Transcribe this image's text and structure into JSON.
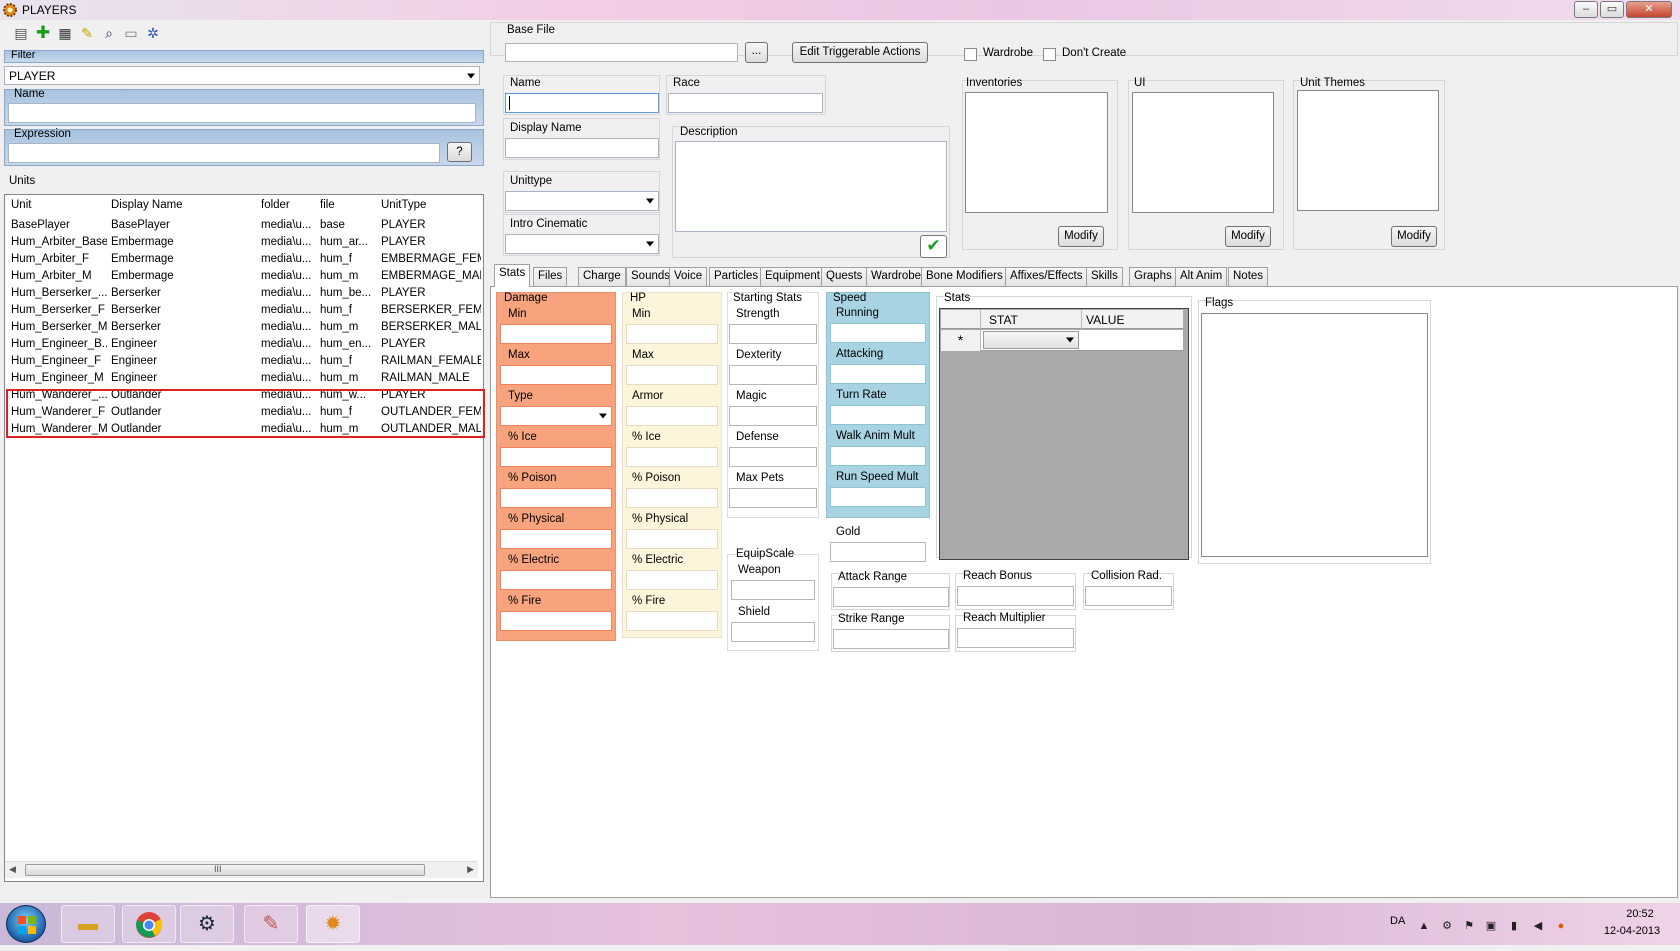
{
  "window": {
    "title": "PLAYERS"
  },
  "filter": {
    "group_label": "Filter",
    "selected": "PLAYER",
    "name_label": "Name",
    "name_value": "",
    "expression_label": "Expression",
    "expression_value": "",
    "help_button": "?"
  },
  "units": {
    "label": "Units",
    "columns": [
      "Unit",
      "Display Name",
      "folder",
      "file",
      "UnitType"
    ],
    "rows": [
      [
        "BasePlayer",
        "BasePlayer",
        "media\\u...",
        "base",
        "PLAYER"
      ],
      [
        "Hum_Arbiter_Base",
        "Embermage",
        "media\\u...",
        "hum_ar...",
        "PLAYER"
      ],
      [
        "Hum_Arbiter_F",
        "Embermage",
        "media\\u...",
        "hum_f",
        "EMBERMAGE_FEMA"
      ],
      [
        "Hum_Arbiter_M",
        "Embermage",
        "media\\u...",
        "hum_m",
        "EMBERMAGE_MALI"
      ],
      [
        "Hum_Berserker_...",
        "Berserker",
        "media\\u...",
        "hum_be...",
        "PLAYER"
      ],
      [
        "Hum_Berserker_F",
        "Berserker",
        "media\\u...",
        "hum_f",
        "BERSERKER_FEMA"
      ],
      [
        "Hum_Berserker_M",
        "Berserker",
        "media\\u...",
        "hum_m",
        "BERSERKER_MALE"
      ],
      [
        "Hum_Engineer_B...",
        "Engineer",
        "media\\u...",
        "hum_en...",
        "PLAYER"
      ],
      [
        "Hum_Engineer_F",
        "Engineer",
        "media\\u...",
        "hum_f",
        "RAILMAN_FEMALE"
      ],
      [
        "Hum_Engineer_M",
        "Engineer",
        "media\\u...",
        "hum_m",
        "RAILMAN_MALE"
      ],
      [
        "Hum_Wanderer_...",
        "Outlander",
        "media\\u...",
        "hum_w...",
        "PLAYER"
      ],
      [
        "Hum_Wanderer_F",
        "Outlander",
        "media\\u...",
        "hum_f",
        "OUTLANDER_FEMA"
      ],
      [
        "Hum_Wanderer_M",
        "Outlander",
        "media\\u...",
        "hum_m",
        "OUTLANDER_MALE"
      ]
    ],
    "scroll_grip": "III"
  },
  "form": {
    "base_file_label": "Base File",
    "base_file_value": "",
    "browse_button": "...",
    "edit_triggerable_button": "Edit Triggerable Actions",
    "wardrobe_label": "Wardrobe",
    "dont_create_label": "Don't Create",
    "name_label": "Name",
    "race_label": "Race",
    "display_name_label": "Display Name",
    "description_label": "Description",
    "unittype_label": "Unittype",
    "intro_cinematic_label": "Intro Cinematic",
    "inventories_label": "Inventories",
    "ui_label": "UI",
    "unit_themes_label": "Unit Themes",
    "modify_label": "Modify"
  },
  "tabs": [
    "Stats",
    "Files",
    "Charge",
    "Sounds",
    "Voice",
    "Particles",
    "Equipment",
    "Quests",
    "Wardrobe",
    "Bone Modifiers",
    "Affixes/Effects",
    "Skills",
    "Graphs",
    "Alt Anim",
    "Notes"
  ],
  "stats": {
    "damage": {
      "title": "Damage",
      "fields": [
        "Min",
        "Max",
        "Type",
        "% Ice",
        "% Poison",
        "% Physical",
        "% Electric",
        "% Fire"
      ]
    },
    "hp": {
      "title": "HP",
      "fields": [
        "Min",
        "Max",
        "Armor",
        "% Ice",
        "% Poison",
        "% Physical",
        "% Electric",
        "% Fire"
      ]
    },
    "starting": {
      "title": "Starting Stats",
      "fields": [
        "Strength",
        "Dexterity",
        "Magic",
        "Defense",
        "Max Pets"
      ]
    },
    "equipscale": {
      "title": "EquipScale",
      "fields": [
        "Weapon",
        "Shield"
      ]
    },
    "speed": {
      "title": "Speed",
      "fields": [
        "Running",
        "Attacking",
        "Turn Rate",
        "Walk Anim Mult",
        "Run Speed Mult"
      ]
    },
    "gold_label": "Gold",
    "attack_range_label": "Attack Range",
    "strike_range_label": "Strike Range",
    "reach_bonus_label": "Reach Bonus",
    "reach_multiplier_label": "Reach Multiplier",
    "collision_label": "Collision Rad.",
    "stats_grid": {
      "title": "Stats",
      "col_stat": "STAT",
      "col_value": "VALUE",
      "new_row_marker": "*"
    },
    "flags_label": "Flags"
  },
  "taskbar": {
    "language": "DA",
    "time": "20:52",
    "date": "12-04-2013"
  }
}
